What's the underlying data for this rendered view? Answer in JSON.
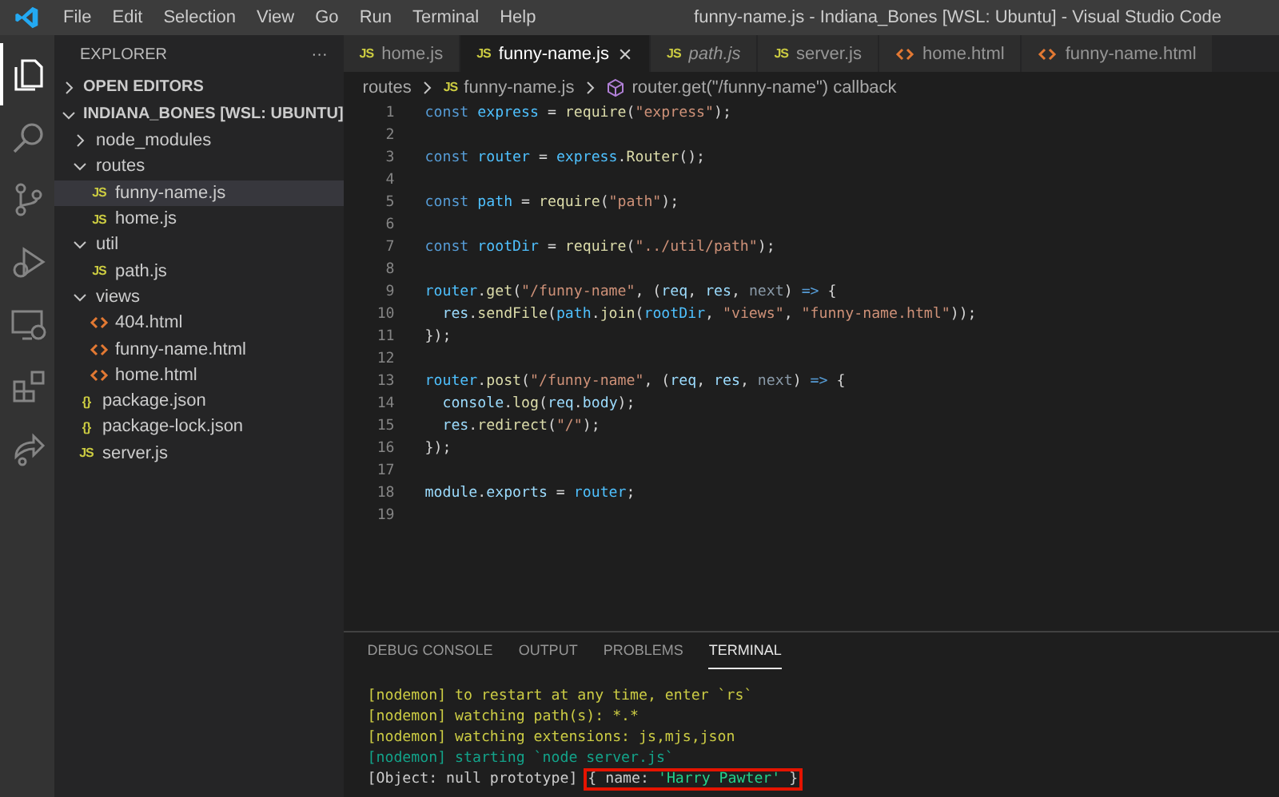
{
  "window": {
    "title": "funny-name.js - Indiana_Bones [WSL: Ubuntu] - Visual Studio Code"
  },
  "menu": [
    "File",
    "Edit",
    "Selection",
    "View",
    "Go",
    "Run",
    "Terminal",
    "Help"
  ],
  "activity_bar": [
    {
      "kind": "explorer",
      "selected": true
    },
    {
      "kind": "search",
      "selected": false
    },
    {
      "kind": "source-control",
      "selected": false
    },
    {
      "kind": "debug",
      "selected": false
    },
    {
      "kind": "remote",
      "selected": false
    },
    {
      "kind": "extensions",
      "selected": false
    },
    {
      "kind": "share",
      "selected": false
    }
  ],
  "sidebar": {
    "title": "EXPLORER",
    "more": "···",
    "sections": [
      {
        "label": "OPEN EDITORS",
        "expanded": false
      },
      {
        "label": "INDIANA_BONES [WSL: UBUNTU]",
        "expanded": true
      }
    ],
    "tree": [
      {
        "kind": "folder",
        "label": "node_modules",
        "expanded": false,
        "selected": false
      },
      {
        "kind": "folder",
        "label": "routes",
        "expanded": true,
        "selected": false,
        "children": [
          {
            "kind": "js",
            "icon": "JS",
            "label": "funny-name.js",
            "selected": true
          },
          {
            "kind": "js",
            "icon": "JS",
            "label": "home.js",
            "selected": false
          }
        ]
      },
      {
        "kind": "folder",
        "label": "util",
        "expanded": true,
        "selected": false,
        "children": [
          {
            "kind": "js",
            "icon": "JS",
            "label": "path.js",
            "selected": false
          }
        ]
      },
      {
        "kind": "folder",
        "label": "views",
        "expanded": true,
        "selected": false,
        "children": [
          {
            "kind": "html",
            "label": "404.html",
            "selected": false
          },
          {
            "kind": "html",
            "label": "funny-name.html",
            "selected": false
          },
          {
            "kind": "html",
            "label": "home.html",
            "selected": false
          }
        ]
      },
      {
        "kind": "json",
        "icon": "{}",
        "label": "package.json",
        "selected": false
      },
      {
        "kind": "json",
        "icon": "{}",
        "label": "package-lock.json",
        "selected": false
      },
      {
        "kind": "js",
        "icon": "JS",
        "label": "server.js",
        "selected": false
      }
    ]
  },
  "editor": {
    "tabs": [
      {
        "kind": "js",
        "icon": "JS",
        "label": "home.js",
        "selected": false,
        "preview": false
      },
      {
        "kind": "js",
        "icon": "JS",
        "label": "funny-name.js",
        "selected": true,
        "preview": false
      },
      {
        "kind": "js",
        "icon": "JS",
        "label": "path.js",
        "selected": false,
        "preview": true
      },
      {
        "kind": "js",
        "icon": "JS",
        "label": "server.js",
        "selected": false,
        "preview": false
      },
      {
        "kind": "html",
        "label": "home.html",
        "selected": false,
        "preview": false
      },
      {
        "kind": "html",
        "label": "funny-name.html",
        "selected": false,
        "preview": false
      }
    ],
    "breadcrumb": [
      {
        "kind": "folder",
        "label": "routes"
      },
      {
        "kind": "js",
        "icon": "JS",
        "label": "funny-name.js"
      },
      {
        "kind": "symbol",
        "label": "router.get(\"/funny-name\") callback"
      }
    ],
    "lines": [
      {
        "number": "1",
        "tokens": [
          {
            "text": "const ",
            "kind": "kw"
          },
          {
            "text": "express",
            "kind": "const"
          },
          {
            "text": " = ",
            "kind": "punc"
          },
          {
            "text": "require",
            "kind": "fn"
          },
          {
            "text": "(",
            "kind": "punc"
          },
          {
            "text": "\"express\"",
            "kind": "str"
          },
          {
            "text": ");",
            "kind": "punc"
          }
        ]
      },
      {
        "number": "2"
      },
      {
        "number": "3",
        "tokens": [
          {
            "text": "const ",
            "kind": "kw"
          },
          {
            "text": "router",
            "kind": "const"
          },
          {
            "text": " = ",
            "kind": "punc"
          },
          {
            "text": "express",
            "kind": "const"
          },
          {
            "text": ".",
            "kind": "punc"
          },
          {
            "text": "Router",
            "kind": "fn"
          },
          {
            "text": "();",
            "kind": "punc"
          }
        ]
      },
      {
        "number": "4"
      },
      {
        "number": "5",
        "tokens": [
          {
            "text": "const ",
            "kind": "kw"
          },
          {
            "text": "path",
            "kind": "const"
          },
          {
            "text": " = ",
            "kind": "punc"
          },
          {
            "text": "require",
            "kind": "fn"
          },
          {
            "text": "(",
            "kind": "punc"
          },
          {
            "text": "\"path\"",
            "kind": "str"
          },
          {
            "text": ");",
            "kind": "punc"
          }
        ]
      },
      {
        "number": "6"
      },
      {
        "number": "7",
        "tokens": [
          {
            "text": "const ",
            "kind": "kw"
          },
          {
            "text": "rootDir",
            "kind": "const"
          },
          {
            "text": " = ",
            "kind": "punc"
          },
          {
            "text": "require",
            "kind": "fn"
          },
          {
            "text": "(",
            "kind": "punc"
          },
          {
            "text": "\"../util/path\"",
            "kind": "str"
          },
          {
            "text": ");",
            "kind": "punc"
          }
        ]
      },
      {
        "number": "8"
      },
      {
        "number": "9",
        "tokens": [
          {
            "text": "router",
            "kind": "const"
          },
          {
            "text": ".",
            "kind": "punc"
          },
          {
            "text": "get",
            "kind": "fn"
          },
          {
            "text": "(",
            "kind": "punc"
          },
          {
            "text": "\"/funny-name\"",
            "kind": "str"
          },
          {
            "text": ", (",
            "kind": "punc"
          },
          {
            "text": "req",
            "kind": "var"
          },
          {
            "text": ", ",
            "kind": "punc"
          },
          {
            "text": "res",
            "kind": "var"
          },
          {
            "text": ", ",
            "kind": "punc"
          },
          {
            "text": "next",
            "kind": "unused"
          },
          {
            "text": ") ",
            "kind": "punc"
          },
          {
            "text": "=>",
            "kind": "kw"
          },
          {
            "text": " {",
            "kind": "punc"
          }
        ]
      },
      {
        "number": "10",
        "tokens": [
          {
            "text": "  res",
            "kind": "var"
          },
          {
            "text": ".",
            "kind": "punc"
          },
          {
            "text": "sendFile",
            "kind": "fn"
          },
          {
            "text": "(",
            "kind": "punc"
          },
          {
            "text": "path",
            "kind": "const"
          },
          {
            "text": ".",
            "kind": "punc"
          },
          {
            "text": "join",
            "kind": "fn"
          },
          {
            "text": "(",
            "kind": "punc"
          },
          {
            "text": "rootDir",
            "kind": "const"
          },
          {
            "text": ", ",
            "kind": "punc"
          },
          {
            "text": "\"views\"",
            "kind": "str"
          },
          {
            "text": ", ",
            "kind": "punc"
          },
          {
            "text": "\"funny-name.html\"",
            "kind": "str"
          },
          {
            "text": "));",
            "kind": "punc"
          }
        ]
      },
      {
        "number": "11",
        "tokens": [
          {
            "text": "});",
            "kind": "punc"
          }
        ]
      },
      {
        "number": "12"
      },
      {
        "number": "13",
        "tokens": [
          {
            "text": "router",
            "kind": "const"
          },
          {
            "text": ".",
            "kind": "punc"
          },
          {
            "text": "post",
            "kind": "fn"
          },
          {
            "text": "(",
            "kind": "punc"
          },
          {
            "text": "\"/funny-name\"",
            "kind": "str"
          },
          {
            "text": ", (",
            "kind": "punc"
          },
          {
            "text": "req",
            "kind": "var"
          },
          {
            "text": ", ",
            "kind": "punc"
          },
          {
            "text": "res",
            "kind": "var"
          },
          {
            "text": ", ",
            "kind": "punc"
          },
          {
            "text": "next",
            "kind": "unused"
          },
          {
            "text": ") ",
            "kind": "punc"
          },
          {
            "text": "=>",
            "kind": "kw"
          },
          {
            "text": " {",
            "kind": "punc"
          }
        ]
      },
      {
        "number": "14",
        "tokens": [
          {
            "text": "  console",
            "kind": "var"
          },
          {
            "text": ".",
            "kind": "punc"
          },
          {
            "text": "log",
            "kind": "fn"
          },
          {
            "text": "(",
            "kind": "punc"
          },
          {
            "text": "req",
            "kind": "var"
          },
          {
            "text": ".",
            "kind": "punc"
          },
          {
            "text": "body",
            "kind": "var"
          },
          {
            "text": ");",
            "kind": "punc"
          }
        ]
      },
      {
        "number": "15",
        "tokens": [
          {
            "text": "  res",
            "kind": "var"
          },
          {
            "text": ".",
            "kind": "punc"
          },
          {
            "text": "redirect",
            "kind": "fn"
          },
          {
            "text": "(",
            "kind": "punc"
          },
          {
            "text": "\"/\"",
            "kind": "str"
          },
          {
            "text": ");",
            "kind": "punc"
          }
        ]
      },
      {
        "number": "16",
        "tokens": [
          {
            "text": "});",
            "kind": "punc"
          }
        ]
      },
      {
        "number": "17"
      },
      {
        "number": "18",
        "tokens": [
          {
            "text": "module",
            "kind": "var"
          },
          {
            "text": ".",
            "kind": "punc"
          },
          {
            "text": "exports",
            "kind": "var"
          },
          {
            "text": " = ",
            "kind": "punc"
          },
          {
            "text": "router",
            "kind": "const"
          },
          {
            "text": ";",
            "kind": "punc"
          }
        ]
      },
      {
        "number": "19"
      }
    ]
  },
  "panel": {
    "tabs": [
      {
        "label": "DEBUG CONSOLE",
        "selected": false
      },
      {
        "label": "OUTPUT",
        "selected": false
      },
      {
        "label": "PROBLEMS",
        "selected": false
      },
      {
        "label": "TERMINAL",
        "selected": true
      }
    ],
    "terminal": [
      {
        "kind": "warn",
        "text": "[nodemon] to restart at any time, enter `rs`"
      },
      {
        "kind": "warn",
        "text": "[nodemon] watching path(s): *.*"
      },
      {
        "kind": "warn",
        "text": "[nodemon] watching extensions: js,mjs,json"
      },
      {
        "kind": "info",
        "text": "[nodemon] starting `node server.js`"
      },
      {
        "kind": "plain",
        "text": "[Object: null prototype] ",
        "boxed": [
          {
            "text": "{ name: ",
            "kind": "plain"
          },
          {
            "text": "'Harry Pawter'",
            "kind": "str"
          },
          {
            "text": " }",
            "kind": "plain"
          }
        ]
      }
    ]
  }
}
